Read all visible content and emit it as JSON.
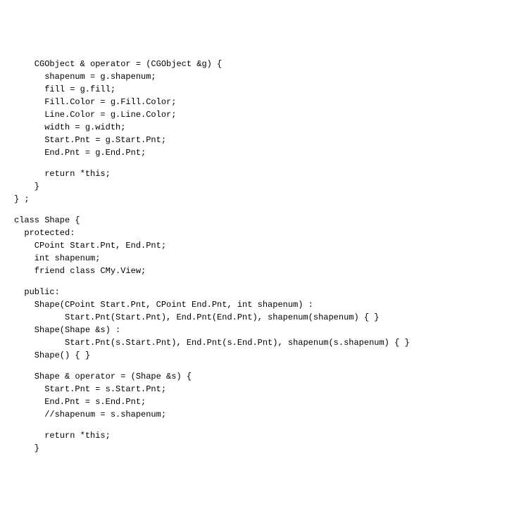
{
  "code": {
    "lines": [
      "    CGObject & operator = (CGObject &g) {",
      "      shapenum = g.shapenum;",
      "      fill = g.fill;",
      "      Fill.Color = g.Fill.Color;",
      "      Line.Color = g.Line.Color;",
      "      width = g.width;",
      "      Start.Pnt = g.Start.Pnt;",
      "      End.Pnt = g.End.Pnt;",
      "",
      "      return *this;",
      "    }",
      "} ;",
      "",
      "class Shape {",
      "  protected:",
      "    CPoint Start.Pnt, End.Pnt;",
      "    int shapenum;",
      "    friend class CMy.View;",
      "",
      "  public:",
      "    Shape(CPoint Start.Pnt, CPoint End.Pnt, int shapenum) :",
      "          Start.Pnt(Start.Pnt), End.Pnt(End.Pnt), shapenum(shapenum) { }",
      "    Shape(Shape &s) :",
      "          Start.Pnt(s.Start.Pnt), End.Pnt(s.End.Pnt), shapenum(s.shapenum) { }",
      "    Shape() { }",
      "",
      "    Shape & operator = (Shape &s) {",
      "      Start.Pnt = s.Start.Pnt;",
      "      End.Pnt = s.End.Pnt;",
      "      //shapenum = s.shapenum;",
      "",
      "      return *this;",
      "    }"
    ]
  }
}
